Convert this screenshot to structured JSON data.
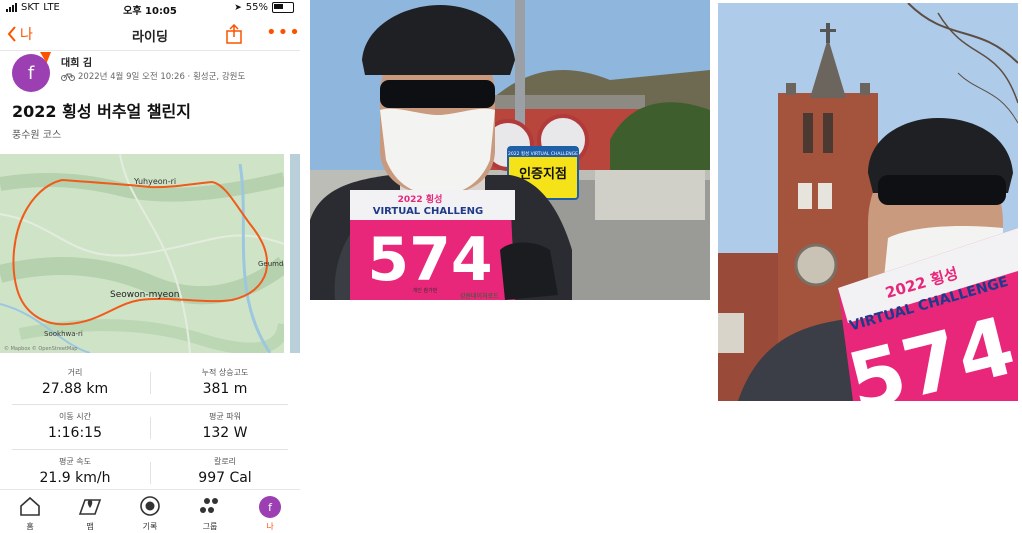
{
  "status_bar": {
    "carrier": "SKT",
    "network": "LTE",
    "time": "오후 10:05",
    "battery": "55%"
  },
  "nav": {
    "back_label": "나",
    "title": "라이딩"
  },
  "activity": {
    "athlete_name": "대희 김",
    "avatar_letter": "f",
    "meta": "2022년 4월 9일 오전 10:26 · 횡성군, 강원도",
    "title": "2022 횡성 버추얼 챌린지",
    "subtitle": "풍수원 코스"
  },
  "map": {
    "labels": {
      "north": "Yuhyeon-ri",
      "east": "Geumda",
      "center": "Seowon-myeon",
      "south": "Sookhwa-ri",
      "copyright": "© Mapbox © OpenStreetMap"
    }
  },
  "stats": [
    {
      "label": "거리",
      "value": "27.88 km"
    },
    {
      "label": "누적 상승고도",
      "value": "381 m"
    },
    {
      "label": "이동 시간",
      "value": "1:16:15"
    },
    {
      "label": "평균 파워",
      "value": "132 W"
    },
    {
      "label": "평균 속도",
      "value": "21.9 km/h"
    },
    {
      "label": "칼로리",
      "value": "997 Cal"
    }
  ],
  "tabs": [
    {
      "label": "홈",
      "icon": "home-icon"
    },
    {
      "label": "맵",
      "icon": "map-icon"
    },
    {
      "label": "기록",
      "icon": "record-icon"
    },
    {
      "label": "그룹",
      "icon": "groups-icon"
    },
    {
      "label": "나",
      "icon": "avatar"
    }
  ],
  "photo1": {
    "bib_title": "2022 횡성",
    "bib_sub": "VIRTUAL CHALLENG",
    "bib_number": "574",
    "bib_footer": "개인 참가번",
    "sign_text": "인증지점",
    "sign_header": "2022 횡성 VIRTUAL CHALLENGE",
    "bib_sponsor": "강원네이처로드"
  },
  "photo2": {
    "bib_title": "2022 횡성",
    "bib_sub": "VIRTUAL CHALLENGE",
    "bib_number": "574"
  },
  "colors": {
    "accent": "#fc5200",
    "avatar": "#9b3fb3",
    "bib": "#e8267a"
  }
}
